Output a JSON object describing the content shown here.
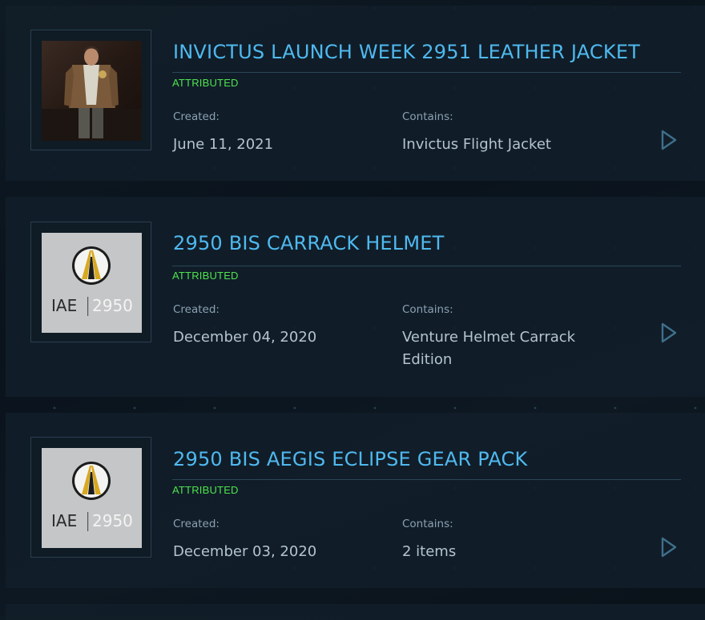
{
  "pledges": [
    {
      "title": "INVICTUS LAUNCH WEEK 2951 LEATHER JACKET",
      "status": "ATTRIBUTED",
      "created_label": "Created:",
      "created_value": "June 11, 2021",
      "contains_label": "Contains:",
      "contains_value": "Invictus Flight Jacket",
      "thumbnail": "character-jacket-photo"
    },
    {
      "title": "2950 BIS CARRACK HELMET",
      "status": "ATTRIBUTED",
      "created_label": "Created:",
      "created_value": "December 04, 2020",
      "contains_label": "Contains:",
      "contains_value_line1": "Venture Helmet Carrack",
      "contains_value_line2": "Edition",
      "thumbnail": "iae-2950-logo",
      "logo_text_left": "IAE",
      "logo_text_right": "2950"
    },
    {
      "title": "2950 BIS AEGIS ECLIPSE GEAR PACK",
      "status": "ATTRIBUTED",
      "created_label": "Created:",
      "created_value": "December 03, 2020",
      "contains_label": "Contains:",
      "contains_value": "2 items",
      "thumbnail": "iae-2950-logo",
      "logo_text_left": "IAE",
      "logo_text_right": "2950"
    }
  ],
  "colors": {
    "title": "#4fb9ef",
    "status": "#4ee34e",
    "label": "#8ba1b2",
    "value": "#b4c4cf"
  }
}
